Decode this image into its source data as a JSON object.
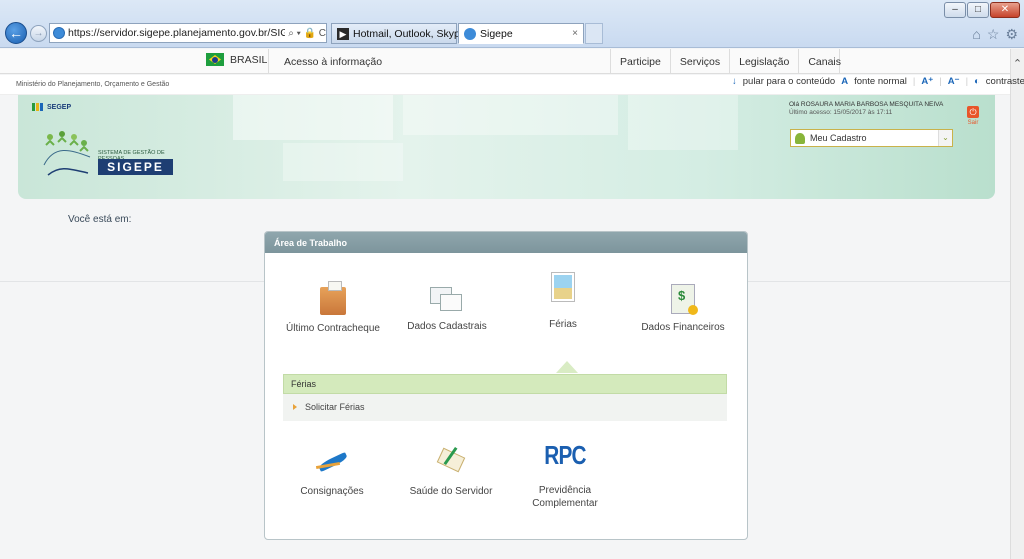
{
  "browser": {
    "url": "https://servidor.sigepe.planejamento.gov.br/SIGEPE-PortalServidc",
    "url_tools": "⌕ ▾ 🔒 C",
    "tabs": [
      {
        "label": "Hotmail, Outlook, Skype, Noti..."
      },
      {
        "label": "Sigepe",
        "close": "×"
      }
    ],
    "window_buttons": [
      "–",
      "□",
      "✕"
    ],
    "tool_icons": [
      "⌂",
      "☆",
      "⚙"
    ]
  },
  "gov_bar": {
    "brasil": "BRASIL",
    "acesso": "Acesso à informação",
    "nav": [
      "Participe",
      "Serviços",
      "Legislação",
      "Canais"
    ]
  },
  "ministry": "Ministério do Planejamento, Orçamento e Gestão",
  "accessibility": {
    "pular_icon": "↓",
    "pular": "pular para o conteúdo",
    "fonte_icon": "A",
    "fonte": "fonte normal",
    "a_plus": "A⁺",
    "a_minus": "A⁻",
    "contraste_icon": "◐",
    "contraste": "contraste"
  },
  "header": {
    "segep": "SEGEP",
    "sigepe_sub": "SISTEMA DE GESTÃO DE PESSOAS",
    "sigepe_logo": "SIGEPE",
    "greeting": "Olá ROSAURA MARIA BARBOSA MESQUITA NEIVA",
    "last_access": "Último acesso: 15/05/2017 às 17:11",
    "sair": "Sair",
    "sair_icon": "⏻",
    "meu_cadastro": "Meu Cadastro",
    "dropdown_arrow": "⌄"
  },
  "breadcrumb": "Você está em:",
  "panel": {
    "title": "Área de Trabalho",
    "tiles": {
      "contracheque": "Último Contracheque",
      "dados_cadastrais": "Dados Cadastrais",
      "ferias": "Férias",
      "dados_financeiros": "Dados Financeiros",
      "consignacoes": "Consignações",
      "saude": "Saúde do Servidor",
      "rpc_logo": "RPC",
      "previdencia": "Previdência Complementar"
    },
    "submenu": {
      "title": "Férias",
      "items": [
        "Solicitar Férias"
      ]
    }
  },
  "colors": {
    "accent_green": "#d4eabc",
    "panel_header": "#7d959c",
    "sigepe_blue": "#1e3e73"
  }
}
